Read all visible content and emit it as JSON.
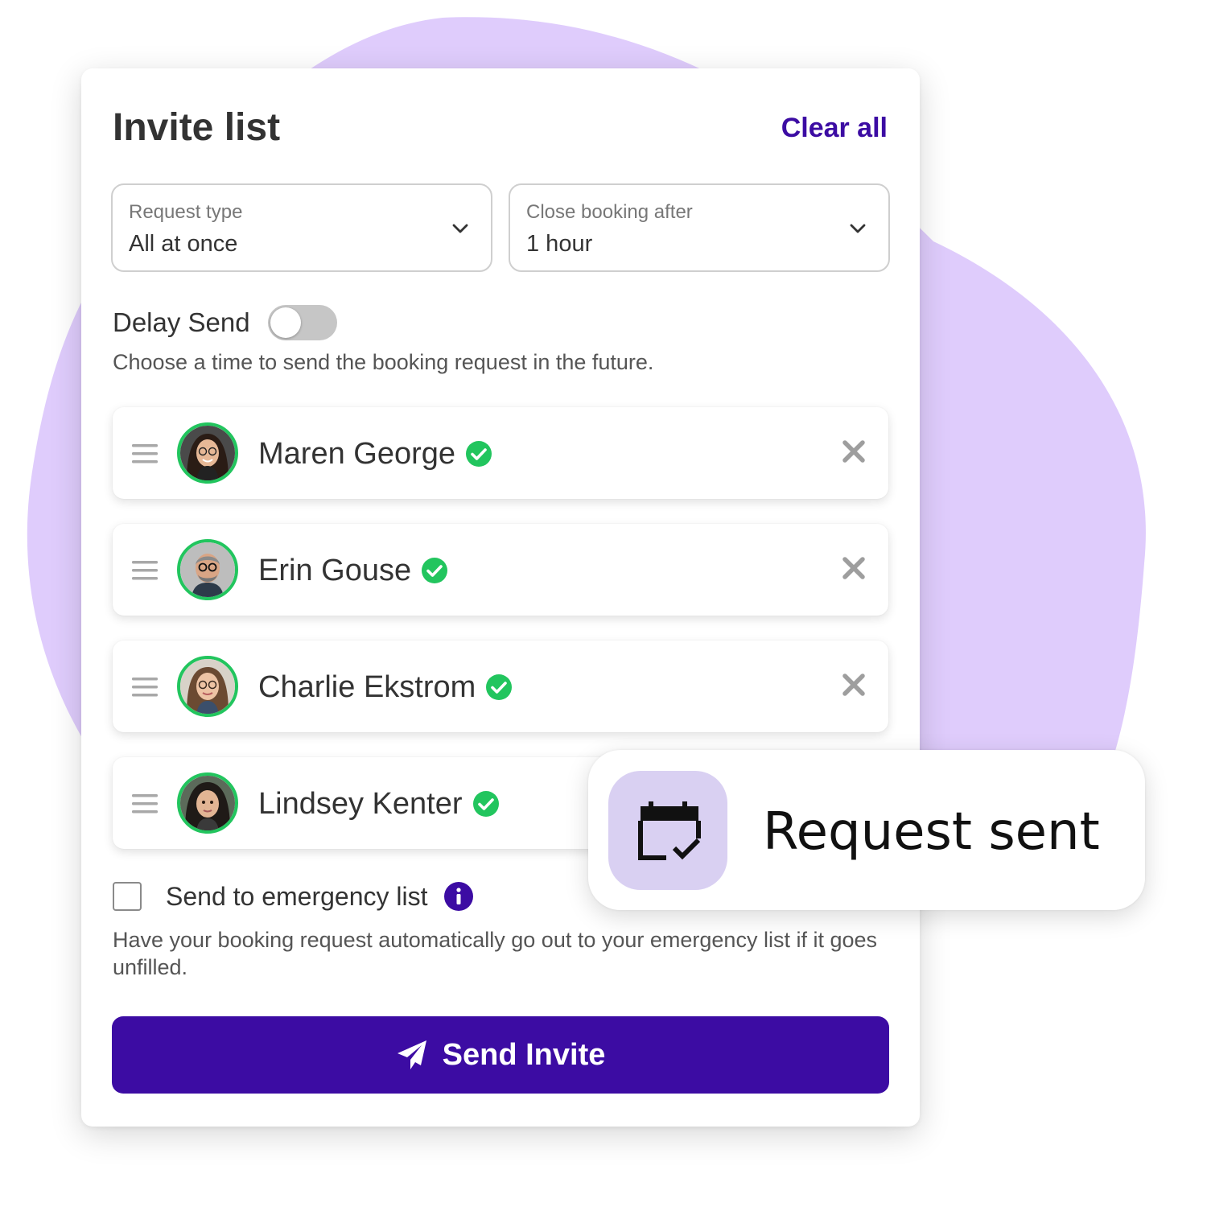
{
  "invite": {
    "title": "Invite list",
    "clear_all_label": "Clear all"
  },
  "filters": {
    "request_type": {
      "label": "Request type",
      "value": "All at once"
    },
    "close_booking": {
      "label": "Close booking after",
      "value": "1 hour"
    }
  },
  "delay_send": {
    "label": "Delay Send",
    "enabled": false,
    "description": "Choose a time to send the booking request in the future."
  },
  "invitees": [
    {
      "name": "Maren George",
      "verified": true
    },
    {
      "name": "Erin Gouse",
      "verified": true
    },
    {
      "name": "Charlie Ekstrom",
      "verified": true
    },
    {
      "name": "Lindsey Kenter",
      "verified": true
    }
  ],
  "emergency": {
    "label": "Send to emergency list",
    "checked": false,
    "description": "Have your booking request automatically go out to your emergency list if it goes unfilled."
  },
  "send_button": {
    "label": "Send Invite"
  },
  "toast": {
    "message": "Request sent"
  },
  "icons": {
    "chevron": "chevron-down-icon",
    "drag": "drag-handle-icon",
    "verified": "verified-check-icon",
    "remove": "close-icon",
    "info": "info-icon",
    "send": "paper-plane-icon",
    "calendar": "calendar-check-icon"
  },
  "colors": {
    "accent": "#3c0ca3",
    "verified": "#22c55e",
    "blob": "#dfccfc",
    "toast_tile": "#d9d0f2",
    "remove_icon": "#9e9e9e"
  }
}
